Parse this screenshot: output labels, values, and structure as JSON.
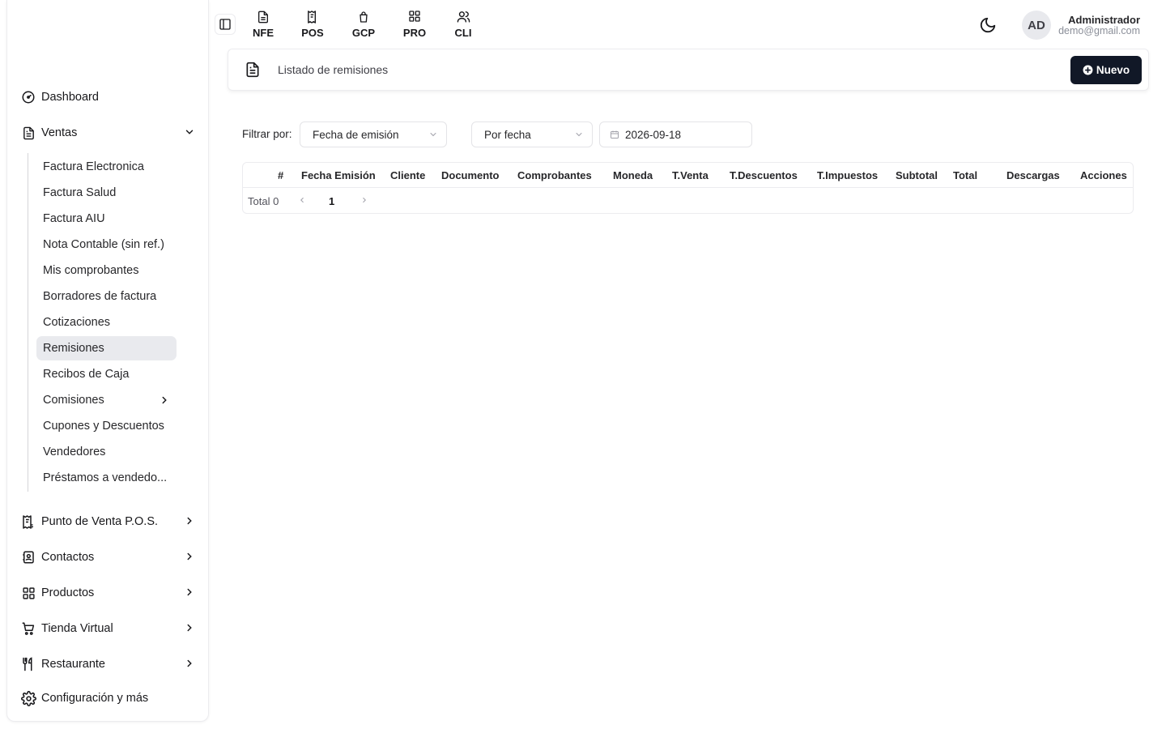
{
  "sidebar": {
    "items": [
      {
        "label": "Dashboard",
        "icon": "gauge-icon"
      },
      {
        "label": "Ventas",
        "icon": "document-icon"
      },
      {
        "label": "Punto de Venta P.O.S.",
        "icon": "receipt-icon"
      },
      {
        "label": "Contactos",
        "icon": "contacts-icon"
      },
      {
        "label": "Productos",
        "icon": "grid-icon"
      },
      {
        "label": "Tienda Virtual",
        "icon": "cart-icon"
      },
      {
        "label": "Restaurante",
        "icon": "utensils-icon"
      },
      {
        "label": "Configuración y más",
        "icon": "gear-icon"
      }
    ],
    "ventas_sub": [
      {
        "label": "Factura Electronica"
      },
      {
        "label": "Factura Salud"
      },
      {
        "label": "Factura AIU"
      },
      {
        "label": "Nota Contable (sin ref.)"
      },
      {
        "label": "Mis comprobantes"
      },
      {
        "label": "Borradores de factura"
      },
      {
        "label": "Cotizaciones"
      },
      {
        "label": "Remisiones"
      },
      {
        "label": "Recibos de Caja"
      },
      {
        "label": "Comisiones"
      },
      {
        "label": "Cupones y Descuentos"
      },
      {
        "label": "Vendedores"
      },
      {
        "label": "Préstamos a vendedo..."
      }
    ]
  },
  "topbar": {
    "tabs": [
      {
        "label": "NFE",
        "icon": "document-icon"
      },
      {
        "label": "POS",
        "icon": "receipt-icon"
      },
      {
        "label": "GCP",
        "icon": "bag-icon"
      },
      {
        "label": "PRO",
        "icon": "grid-icon"
      },
      {
        "label": "CLI",
        "icon": "users-icon"
      }
    ],
    "user": {
      "initials": "AD",
      "name": "Administrador",
      "email": "demo@gmail.com"
    }
  },
  "header": {
    "title": "Listado de remisiones",
    "new_label": "Nuevo"
  },
  "filters": {
    "label": "Filtrar por:",
    "field_select": "Fecha de emisión",
    "mode_select": "Por fecha",
    "date_value": "2026-09-18"
  },
  "table": {
    "columns": [
      "#",
      "Fecha Emisión",
      "Cliente",
      "Documento",
      "Comprobantes",
      "Moneda",
      "T.Venta",
      "T.Descuentos",
      "T.Impuestos",
      "Subtotal",
      "Total",
      "Descargas",
      "Acciones"
    ],
    "total_label": "Total 0",
    "current_page": "1"
  },
  "colors": {
    "primary_button": "#111827",
    "active_item_bg": "#e9eaee",
    "border": "#ececef"
  }
}
